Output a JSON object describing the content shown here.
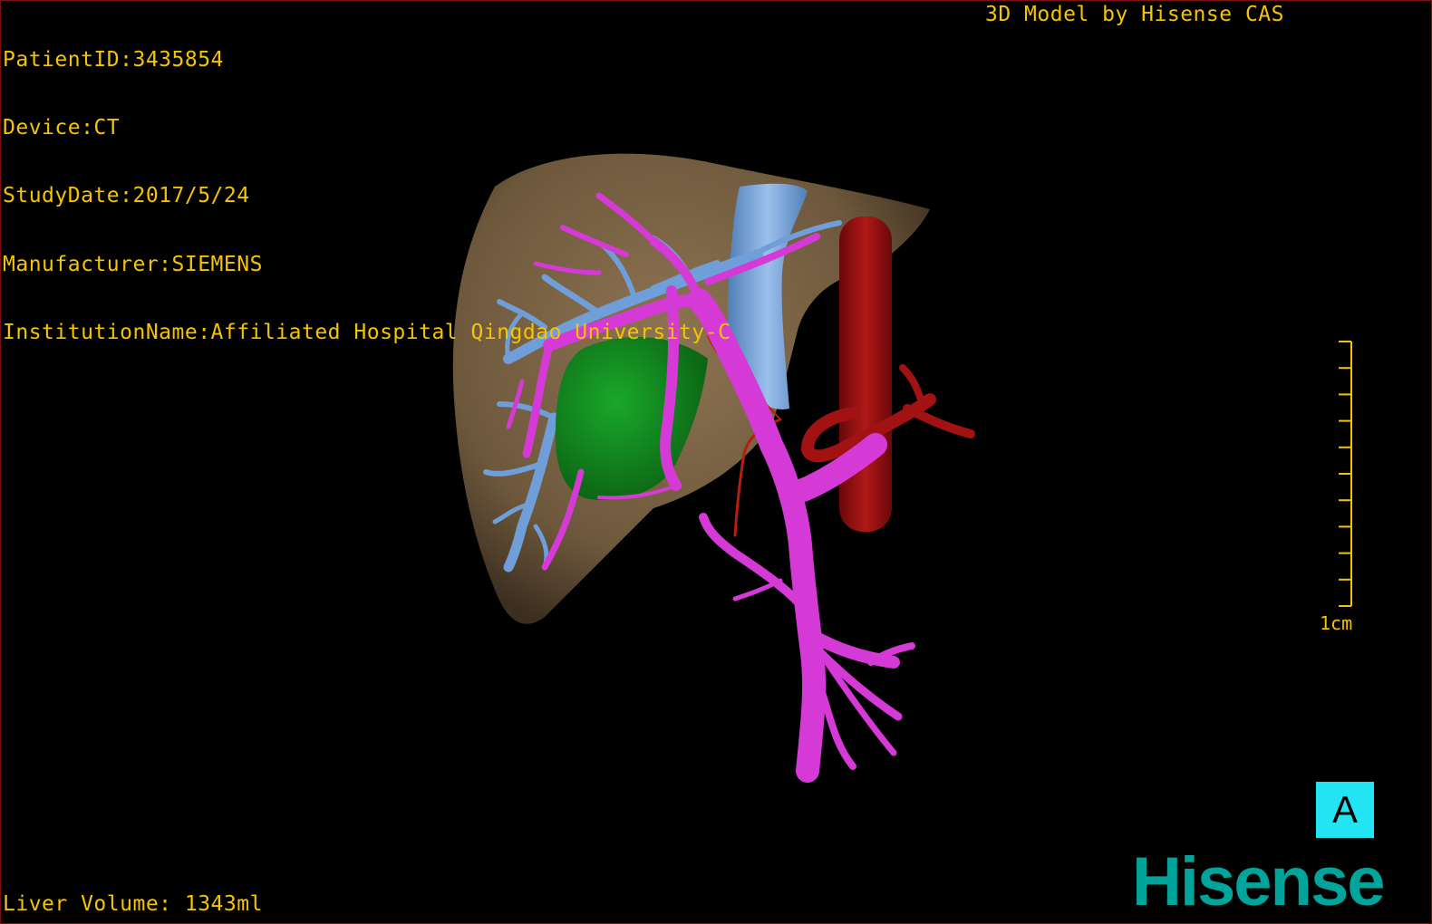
{
  "patient_info": {
    "patient_id": "PatientID:3435854",
    "device": "Device:CT",
    "study_date": "StudyDate:2017/5/24",
    "manufacturer": "Manufacturer:SIEMENS",
    "institution": "InstitutionName:Affiliated Hospital Qingdao University-C"
  },
  "model_credit": "3D Model by Hisense CAS",
  "liver_volume": "Liver Volume: 1343ml",
  "scale_bar": {
    "label": "1cm",
    "ticks": 10
  },
  "view_button": {
    "label": "A"
  },
  "brand_logo": "Hisense",
  "icons": {
    "orientation": "view-orientation-icon",
    "scale": "scale-bar-icon"
  },
  "colors": {
    "overlay_text": "#f5c400",
    "liver": "#7a6446",
    "hepatic_vein": "#6a9ad4",
    "portal_vein": "#d63ad6",
    "tumor": "#0f8a1a",
    "artery": "#a01010",
    "view_button": "#22e4f2",
    "brand": "#00a49a"
  }
}
